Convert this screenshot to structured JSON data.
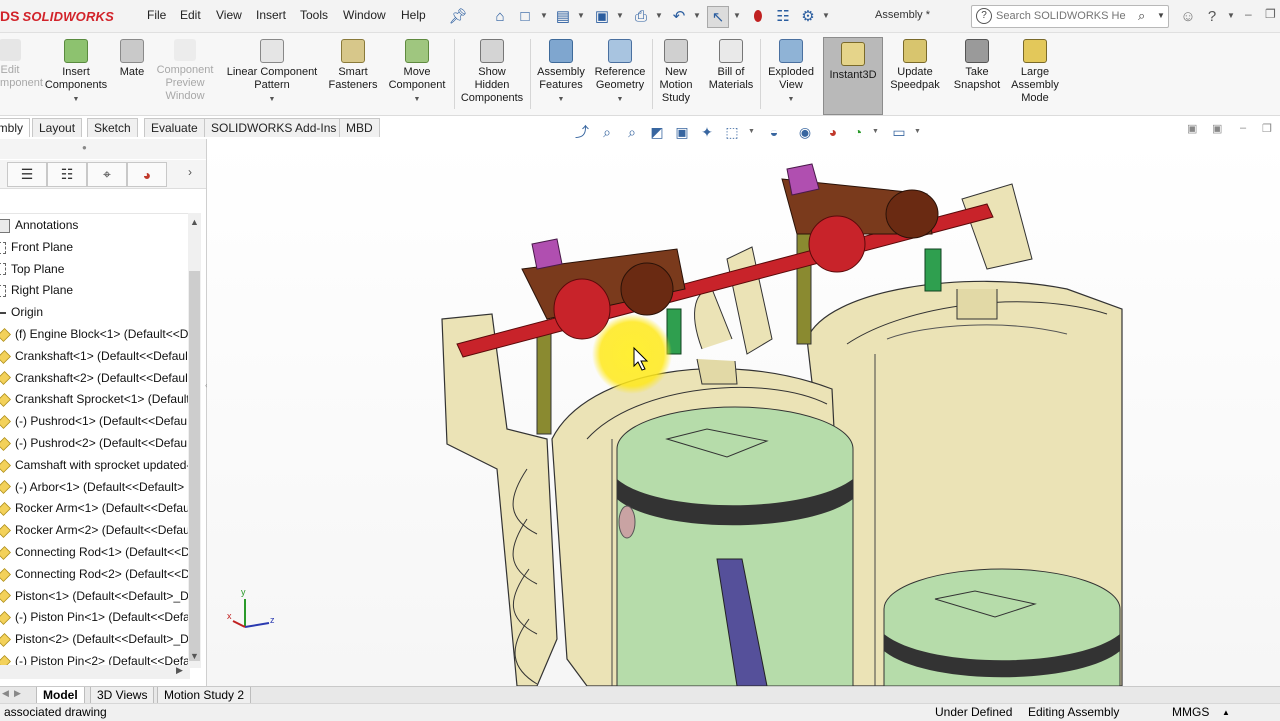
{
  "app": {
    "logo_prefix": "DS",
    "logo_text": "SOLIDWORKS",
    "doc_title": "Assembly *",
    "search_placeholder": "Search SOLIDWORKS Help"
  },
  "menu": [
    "File",
    "Edit",
    "View",
    "Insert",
    "Tools",
    "Window",
    "Help"
  ],
  "toolbar": {
    "edit_component": "Edit\nComponent",
    "insert_components": "Insert\nComponents",
    "mate": "Mate",
    "component_preview": "Component\nPreview\nWindow",
    "linear_pattern": "Linear Component\nPattern",
    "smart_fasteners": "Smart\nFasteners",
    "move_component": "Move\nComponent",
    "show_hidden": "Show\nHidden\nComponents",
    "assembly_features": "Assembly\nFeatures",
    "reference_geometry": "Reference\nGeometry",
    "new_motion_study": "New\nMotion\nStudy",
    "bill_of_materials": "Bill of\nMaterials",
    "exploded_view": "Exploded\nView",
    "instant3d": "Instant3D",
    "update_speedpak": "Update\nSpeedpak",
    "take_snapshot": "Take\nSnapshot",
    "large_assembly": "Large\nAssembly\nMode"
  },
  "tabs": [
    "Assembly",
    "Layout",
    "Sketch",
    "Evaluate",
    "SOLIDWORKS Add-Ins",
    "MBD"
  ],
  "tree": [
    {
      "label": "Annotations",
      "icon": "annotations-icon"
    },
    {
      "label": "Front Plane",
      "icon": "plane-icon"
    },
    {
      "label": "Top Plane",
      "icon": "plane-icon"
    },
    {
      "label": "Right Plane",
      "icon": "plane-icon"
    },
    {
      "label": "Origin",
      "icon": "origin-icon"
    },
    {
      "label": "(f) Engine Block<1> (Default<<D",
      "icon": "part-icon"
    },
    {
      "label": "Crankshaft<1> (Default<<Defaul",
      "icon": "part-icon"
    },
    {
      "label": "Crankshaft<2> (Default<<Defaul",
      "icon": "part-icon"
    },
    {
      "label": "Crankshaft Sprocket<1> (Default",
      "icon": "part-icon"
    },
    {
      "label": "(-) Pushrod<1> (Default<<Defau",
      "icon": "part-icon"
    },
    {
      "label": "(-) Pushrod<2> (Default<<Defau",
      "icon": "part-icon"
    },
    {
      "label": "Camshaft with sprocket updated-",
      "icon": "part-icon"
    },
    {
      "label": "(-) Arbor<1> (Default<<Default>",
      "icon": "part-icon"
    },
    {
      "label": "Rocker Arm<1> (Default<<Defau",
      "icon": "part-icon"
    },
    {
      "label": "Rocker Arm<2> (Default<<Defau",
      "icon": "part-icon"
    },
    {
      "label": "Connecting Rod<1> (Default<<D",
      "icon": "part-icon"
    },
    {
      "label": "Connecting Rod<2> (Default<<D",
      "icon": "part-icon"
    },
    {
      "label": "Piston<1> (Default<<Default>_D",
      "icon": "part-icon"
    },
    {
      "label": "(-) Piston Pin<1> (Default<<Defa",
      "icon": "part-icon"
    },
    {
      "label": "Piston<2> (Default<<Default>_D",
      "icon": "part-icon"
    },
    {
      "label": "(-) Piston Pin<2> (Default<<Defa",
      "icon": "part-icon"
    }
  ],
  "bottom_tabs": [
    "Model",
    "3D Views",
    "Motion Study 2"
  ],
  "status": {
    "left": "associated drawing",
    "defined": "Under Defined",
    "mode": "Editing Assembly",
    "units": "MMGS"
  },
  "triad": {
    "x": "x",
    "y": "y",
    "z": "z"
  },
  "colors": {
    "brand_red": "#d2232a",
    "instant3d_active": "#b9b9b9",
    "engine_block": "#e9e1b4",
    "piston": "#b6dcaa",
    "rocker_arm": "#7a3a1c",
    "shaft": "#c8232a",
    "valve_spring": "#2f9f4f",
    "nut": "#b04fb0",
    "cursor_highlight": "#ffe81a"
  }
}
